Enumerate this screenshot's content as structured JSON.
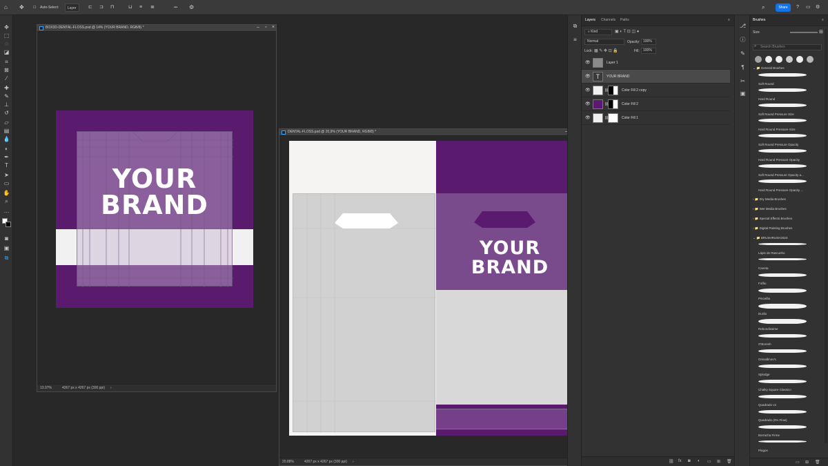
{
  "options_bar": {
    "auto_select_label": "Auto-Select:",
    "auto_select_value": "Layer",
    "more": "•••",
    "share_label": "Share"
  },
  "doc1": {
    "tab_title": "BOX3D-DENTAL-FLOSS.psd @ 14% (YOUR BRAND, RGB/8) *",
    "zoom": "13.97%",
    "size": "4267 px x 4267 px (300 ppi)",
    "brand_line1": "YOUR",
    "brand_line2": "BRAND"
  },
  "doc2": {
    "tab_title": "DENTAL-FLOSS.psd @ 20,9% (YOUR BRAND, RGB/8) *",
    "zoom": "20.88%",
    "size": "4267 px x 4267 px (300 ppi)",
    "brand_line1": "YOUR",
    "brand_line2": "BRAND"
  },
  "layers_panel": {
    "tabs": [
      "Layers",
      "Channels",
      "Paths"
    ],
    "kind_label": "Kind",
    "blend_mode": "Normal",
    "opacity_label": "Opacity:",
    "opacity_value": "100%",
    "lock_label": "Lock:",
    "fill_label": "Fill:",
    "fill_value": "100%",
    "layers": [
      {
        "name": "Layer 1",
        "selected": false
      },
      {
        "name": "YOUR BRAND",
        "selected": true
      },
      {
        "name": "Color Fill 2 copy",
        "selected": false
      },
      {
        "name": "Color Fill 2",
        "selected": false
      },
      {
        "name": "Color Fill 1",
        "selected": false
      }
    ]
  },
  "brushes_panel": {
    "title": "Brushes",
    "size_label": "Size",
    "search_placeholder": "Search Brushes",
    "groups": [
      {
        "name": "General Brushes",
        "open": true,
        "brushes": [
          "Soft Round",
          "Hard Round",
          "Soft Round Pressure Size",
          "Hard Round Pressure Size",
          "Soft Round Pressure Opacity",
          "Hard Round Pressure Opacity",
          "Soft Round Pressure Opacity a...",
          "Hard Round Pressure Opacity ..."
        ]
      },
      {
        "name": "Dry Media Brushes",
        "open": false
      },
      {
        "name": "Wet Media Brushes",
        "open": false
      },
      {
        "name": "Special Effects Brushes",
        "open": false
      },
      {
        "name": "Digital Painting Brushes",
        "open": false
      },
      {
        "name": "BRUSHRUSH2023",
        "open": true,
        "brushes": [
          "Lápis de Rascunho",
          "Caneta",
          "Fofão",
          "Pincelão",
          "Durão",
          "Rebondissime",
          "O'Boresh",
          "Grisaldinov's",
          "Splodge",
          "Chalky Square Classico",
          "Quadrado v2",
          "Quadrado (0% Flow)",
          "Borracha Firme",
          "Pingos"
        ]
      }
    ]
  },
  "colors": {
    "purple": "#5a1b6e",
    "purple_overlay": "#8a6a99",
    "accent": "#1473e6"
  }
}
